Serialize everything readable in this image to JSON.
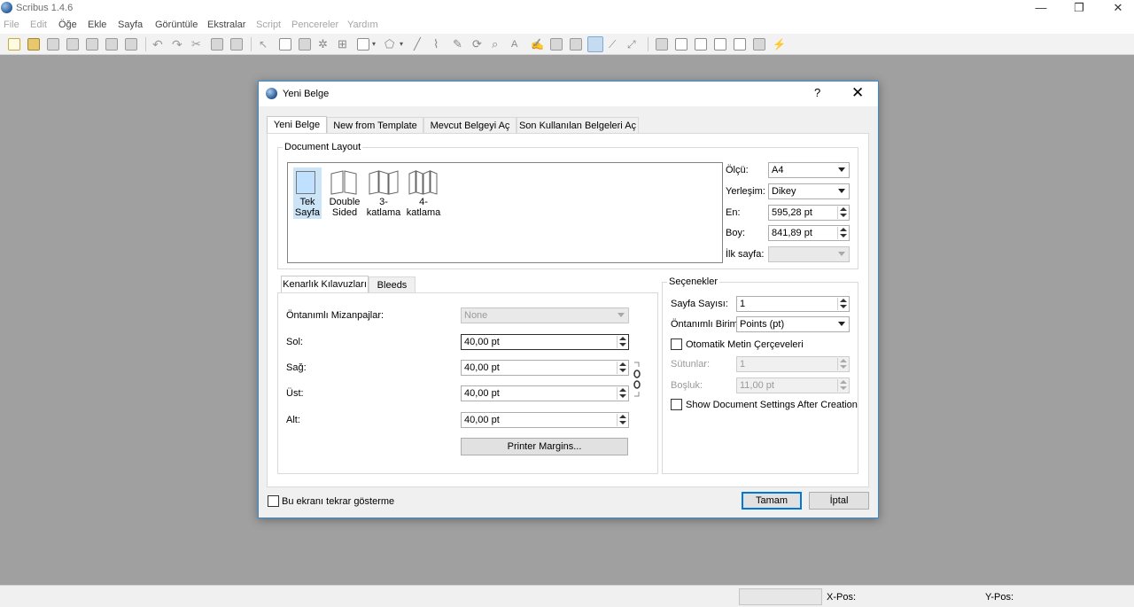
{
  "app": {
    "title": "Scribus 1.4.6",
    "menu": [
      "File",
      "Edit",
      "Öğe",
      "Ekle",
      "Sayfa",
      "Görüntüle",
      "Ekstralar",
      "Script",
      "Pencereler",
      "Yardım"
    ],
    "window_controls": {
      "minimize": "—",
      "maximize": "❐",
      "close": "✕"
    }
  },
  "statusbar": {
    "xpos_label": "X-Pos:",
    "ypos_label": "Y-Pos:"
  },
  "dialog": {
    "title": "Yeni Belge",
    "help": "?",
    "close": "✕",
    "tabs": [
      "Yeni Belge",
      "New from Template",
      "Mevcut Belgeyi Aç",
      "Son Kullanılan Belgeleri Aç"
    ],
    "layout": {
      "group_title": "Document Layout",
      "options": [
        {
          "line1": "Tek",
          "line2": "Sayfa"
        },
        {
          "line1": "Double",
          "line2": "Sided"
        },
        {
          "line1": "3-",
          "line2": "katlama"
        },
        {
          "line1": "4-",
          "line2": "katlama"
        }
      ]
    },
    "page": {
      "size_label": "Ölçü:",
      "size_value": "A4",
      "orient_label": "Yerleşim:",
      "orient_value": "Dikey",
      "width_label": "En:",
      "width_value": "595,28 pt",
      "height_label": "Boy:",
      "height_value": "841,89 pt",
      "first_page_label": "İlk sayfa:",
      "first_page_value": ""
    },
    "margins": {
      "tab_guides": "Kenarlık Kılavuzları",
      "tab_bleeds": "Bleeds",
      "preset_label": "Öntanımlı Mizanpajlar:",
      "preset_value": "None",
      "left_label": "Sol:",
      "left_value": "40,00 pt",
      "right_label": "Sağ:",
      "right_value": "40,00 pt",
      "top_label": "Üst:",
      "top_value": "40,00 pt",
      "bottom_label": "Alt:",
      "bottom_value": "40,00 pt",
      "printer_margins": "Printer Margins..."
    },
    "options": {
      "group_title": "Seçenekler",
      "pages_label": "Sayfa Sayısı:",
      "pages_value": "1",
      "unit_label": "Öntanımlı Birim:",
      "unit_value": "Points (pt)",
      "auto_frames_label": "Otomatik Metin Çerçeveleri",
      "columns_label": "Sütunlar:",
      "columns_value": "1",
      "gap_label": "Boşluk:",
      "gap_value": "11,00 pt",
      "show_settings_label": "Show Document Settings After Creation"
    },
    "footer": {
      "dont_show_label": "Bu ekranı tekrar gösterme",
      "ok": "Tamam",
      "cancel": "İptal"
    }
  },
  "colors": {
    "accent": "#0078d7",
    "selected_thumb": "#cce4f7"
  }
}
